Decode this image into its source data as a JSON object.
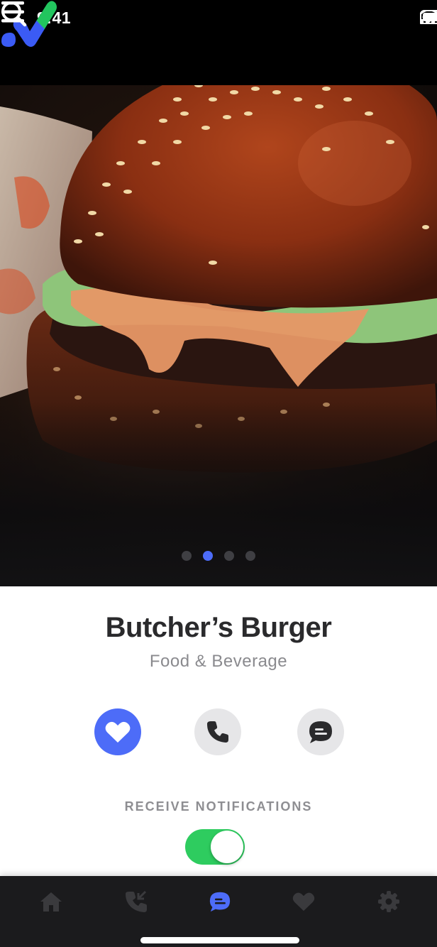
{
  "status_bar": {
    "time": "9:41"
  },
  "header": {
    "logo": "app-logo-checkmark",
    "search_icon": "search-icon",
    "menu_icon": "hamburger-menu-icon"
  },
  "hero": {
    "image": "burger-photo",
    "slides_total": 4,
    "active_slide": 2
  },
  "listing": {
    "name": "Butcher’s Burger",
    "category": "Food & Beverage"
  },
  "actions": [
    {
      "name": "favorite",
      "icon": "heart-icon",
      "active": true
    },
    {
      "name": "call",
      "icon": "phone-icon",
      "active": false
    },
    {
      "name": "message",
      "icon": "chat-bubble-icon",
      "active": false
    }
  ],
  "notifications": {
    "label": "RECEIVE NOTIFICATIONS",
    "enabled": true
  },
  "tab_bar": {
    "items": [
      {
        "name": "home",
        "icon": "home-icon",
        "active": false
      },
      {
        "name": "calls",
        "icon": "phone-callback-icon",
        "active": false
      },
      {
        "name": "messages",
        "icon": "chat-bubble-icon",
        "active": true
      },
      {
        "name": "favorites",
        "icon": "heart-icon",
        "active": false
      },
      {
        "name": "settings",
        "icon": "gear-icon",
        "active": false
      }
    ]
  },
  "colors": {
    "accent": "#4d6cf8",
    "toggle_on": "#2ecc5f",
    "logo_green": "#22c55e",
    "tab_bar_bg": "#1b1b1d",
    "inactive_icon": "#3a3a3d"
  }
}
